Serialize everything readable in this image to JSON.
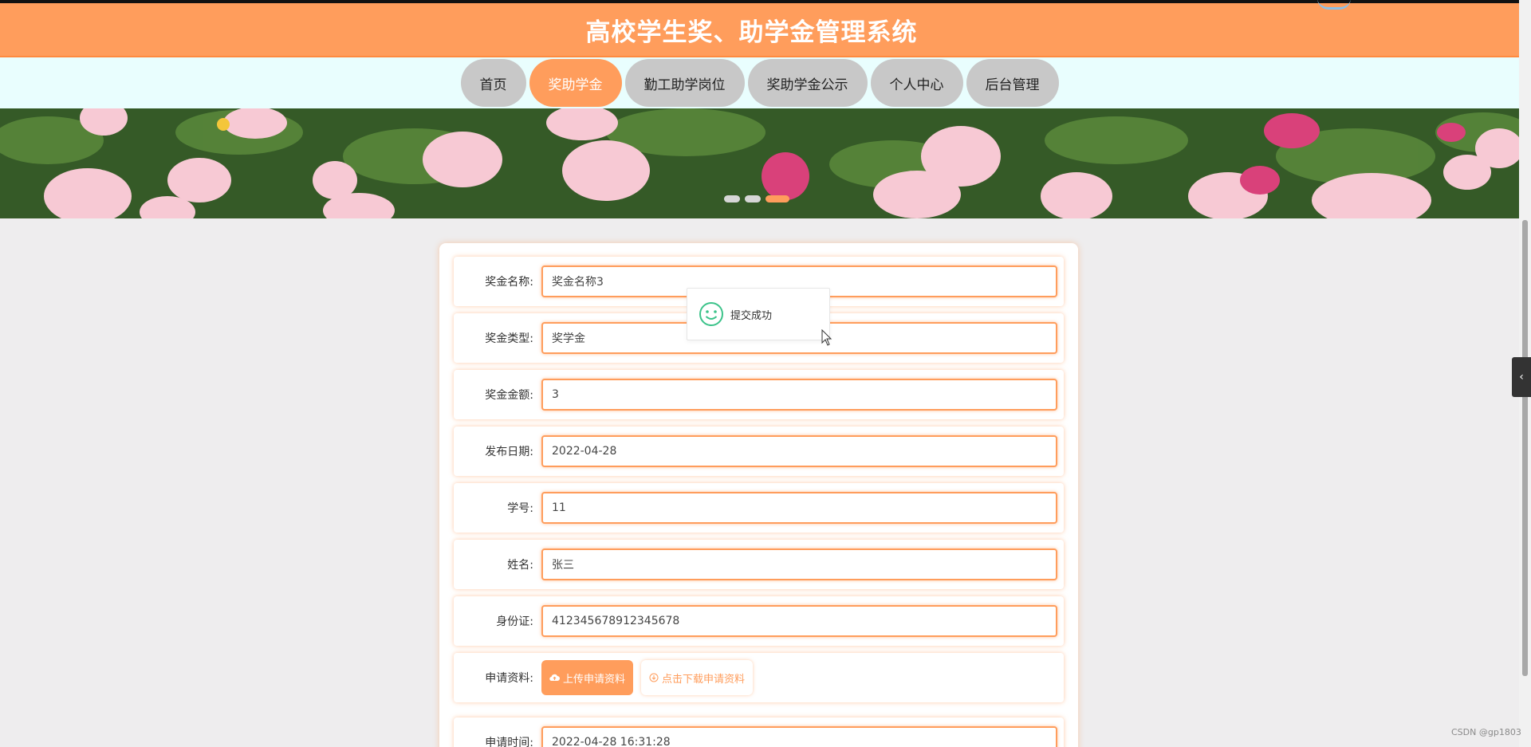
{
  "header": {
    "title": "高校学生奖、助学金管理系统"
  },
  "nav": {
    "items": [
      {
        "label": "首页",
        "active": false
      },
      {
        "label": "奖助学金",
        "active": true
      },
      {
        "label": "勤工助学岗位",
        "active": false
      },
      {
        "label": "奖助学金公示",
        "active": false
      },
      {
        "label": "个人中心",
        "active": false
      },
      {
        "label": "后台管理",
        "active": false
      }
    ]
  },
  "banner": {
    "slide_count": 3,
    "active_slide": 3
  },
  "form": {
    "fields": [
      {
        "label": "奖金名称:",
        "value": "奖金名称3"
      },
      {
        "label": "奖金类型:",
        "value": "奖学金"
      },
      {
        "label": "奖金金额:",
        "value": "3"
      },
      {
        "label": "发布日期:",
        "value": "2022-04-28"
      },
      {
        "label": "学号:",
        "value": "11"
      },
      {
        "label": "姓名:",
        "value": "张三"
      },
      {
        "label": "身份证:",
        "value": "412345678912345678"
      }
    ],
    "attachment": {
      "label": "申请资料:",
      "upload_label": "上传申请资料",
      "download_label": "点击下载申请资料"
    },
    "apply_time": {
      "label": "申请时间:",
      "value": "2022-04-28 16:31:28"
    }
  },
  "toast": {
    "message": "提交成功",
    "icon": "smile-icon"
  },
  "side_toggle": {
    "icon": "chevron-left-icon"
  },
  "watermark": "CSDN @gp1803",
  "colors": {
    "primary": "#ff9d5c",
    "nav_bg": "#e9fefe",
    "toast_icon": "#3cc38a"
  }
}
